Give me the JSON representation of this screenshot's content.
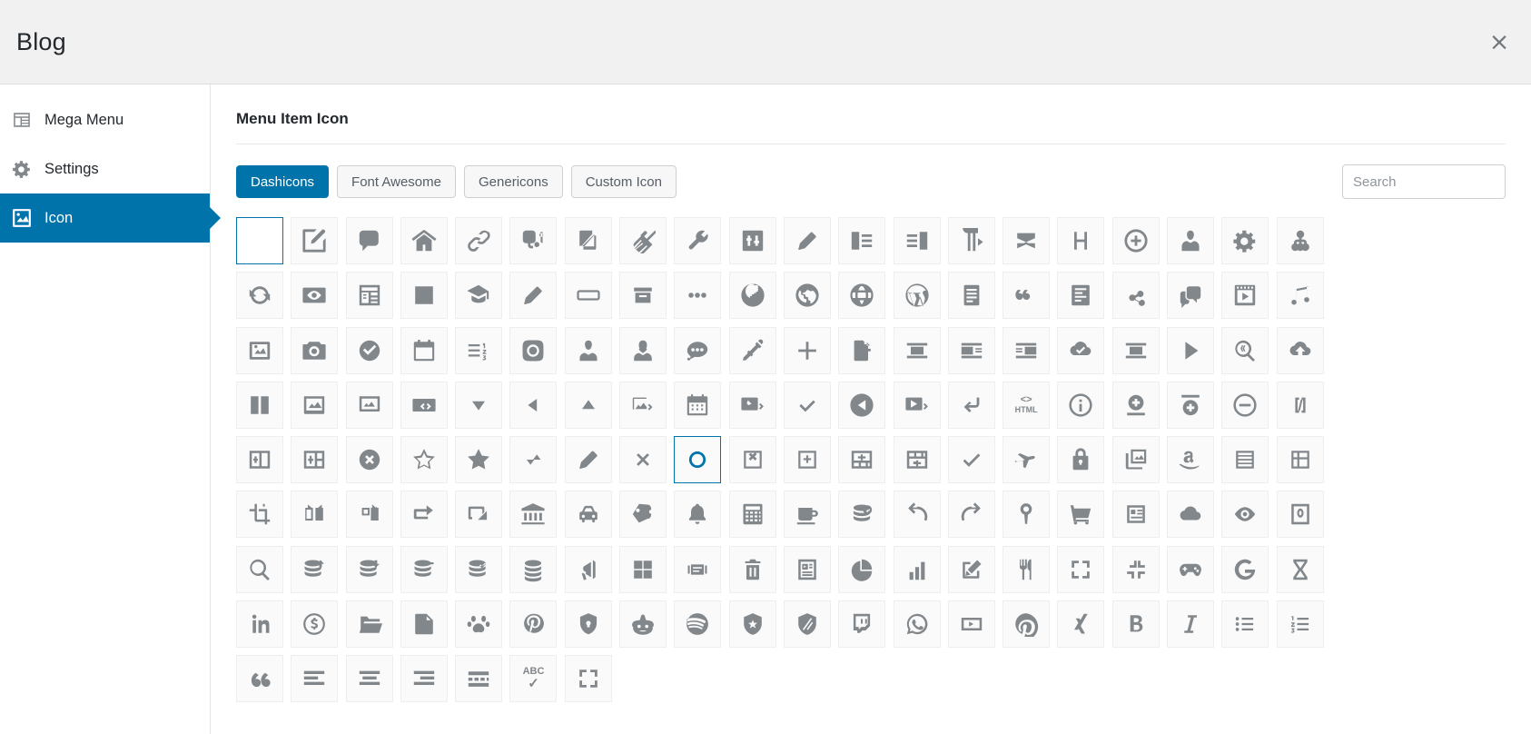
{
  "window": {
    "title": "Blog",
    "close_label": "×",
    "close_icon": "close-icon"
  },
  "sidebar": {
    "items": [
      {
        "label": "Mega Menu",
        "icon": "mega-menu-icon",
        "active": false
      },
      {
        "label": "Settings",
        "icon": "gear-icon",
        "active": false
      },
      {
        "label": "Icon",
        "icon": "image-icon",
        "active": true
      }
    ]
  },
  "main": {
    "panel_title": "Menu Item Icon",
    "tabs": [
      {
        "label": "Dashicons",
        "active": true
      },
      {
        "label": "Font Awesome",
        "active": false
      },
      {
        "label": "Genericons",
        "active": false
      },
      {
        "label": "Custom Icon",
        "active": false
      }
    ],
    "search": {
      "placeholder": "Search",
      "value": ""
    }
  },
  "colors": {
    "accent": "#0073aa",
    "header_bg": "#f1f1f1",
    "icon_gray": "#82878c",
    "cell_bg": "#fafafa"
  },
  "grid": {
    "columns": 20,
    "rows": 9,
    "selected_index": 88,
    "none_index": 0,
    "icons": [
      "none",
      "admin-customizer",
      "admin-comments",
      "admin-home",
      "admin-links",
      "admin-media",
      "admin-multisite",
      "admin-plugins",
      "admin-tools",
      "admin-settings-alt",
      "admin-post",
      "align-left",
      "align-right",
      "editor-paragraph",
      "editor-code-duplicate",
      "editor-help-h",
      "plus-alt-circle",
      "admin-users",
      "admin-generic",
      "admin-network",
      "update",
      "visibility",
      "dashboard",
      "editor-removeformatting",
      "welcome-learn-more",
      "welcome-write-blog",
      "button",
      "archive",
      "ellipsis",
      "site-americas",
      "site-alt",
      "site-default",
      "wordpress",
      "media-text",
      "format-quote",
      "editor-kitchensink",
      "networking",
      "format-chat",
      "media-video",
      "media-audio",
      "format-image",
      "camera",
      "yes-alt",
      "calendar-alt",
      "editor-ol-rtl",
      "instagram",
      "businessman",
      "businesswoman",
      "format-status",
      "color-picker",
      "plus",
      "media-document",
      "align-center",
      "align-pull-left",
      "align-pull-right",
      "cloud-saved",
      "align-none",
      "controls-play",
      "search-code",
      "cloud-upload",
      "columns",
      "images-alt2",
      "format-gallery",
      "embed-generic",
      "arrow-down",
      "arrow-left",
      "arrow-up",
      "embed-photo",
      "calendar",
      "embed-post",
      "yes",
      "controls-back",
      "embed-video",
      "editor-break",
      "html",
      "info-outline",
      "insert-after",
      "insert-before",
      "minus",
      "shortcode",
      "table-col-after",
      "table-col-before",
      "dismiss",
      "star-empty",
      "star-filled",
      "sort",
      "edit-large",
      "no-alt",
      "marker",
      "table-row-delete",
      "table-col-delete",
      "table-row-after",
      "table-row-before",
      "saved",
      "airplane",
      "lock",
      "images-alt",
      "amazon",
      "menu-alt",
      "editor-table",
      "image-crop",
      "image-flip-horizontal",
      "image-rotate-right",
      "controls-repeat",
      "image-filter",
      "bank",
      "car",
      "tickets-alt",
      "bell",
      "calculator",
      "coffee",
      "database-add",
      "undo",
      "redo",
      "location",
      "cart",
      "id",
      "cloud",
      "visibility-eye",
      "book-alt",
      "search",
      "database-import",
      "database-export",
      "database-remove",
      "database-view",
      "database",
      "megaphone",
      "grid-view",
      "slides",
      "trash",
      "media-interactive",
      "chart-pie",
      "chart-bar",
      "edit-page",
      "food",
      "fullscreen-alt",
      "fullscreen-exit-alt",
      "games",
      "google",
      "hourglass",
      "linkedin",
      "money-alt",
      "open-folder",
      "pdf",
      "pets",
      "pinterest",
      "privacy",
      "reddit",
      "spotify",
      "superhero",
      "superhero-alt",
      "twitch",
      "whatsapp",
      "youtube",
      "podio",
      "xing",
      "editor-bold",
      "editor-italic",
      "editor-ul",
      "editor-ol",
      "editor-quote",
      "editor-alignleft",
      "editor-aligncenter",
      "editor-alignright",
      "editor-insertmore",
      "editor-spellcheck",
      "editor-expand"
    ]
  }
}
